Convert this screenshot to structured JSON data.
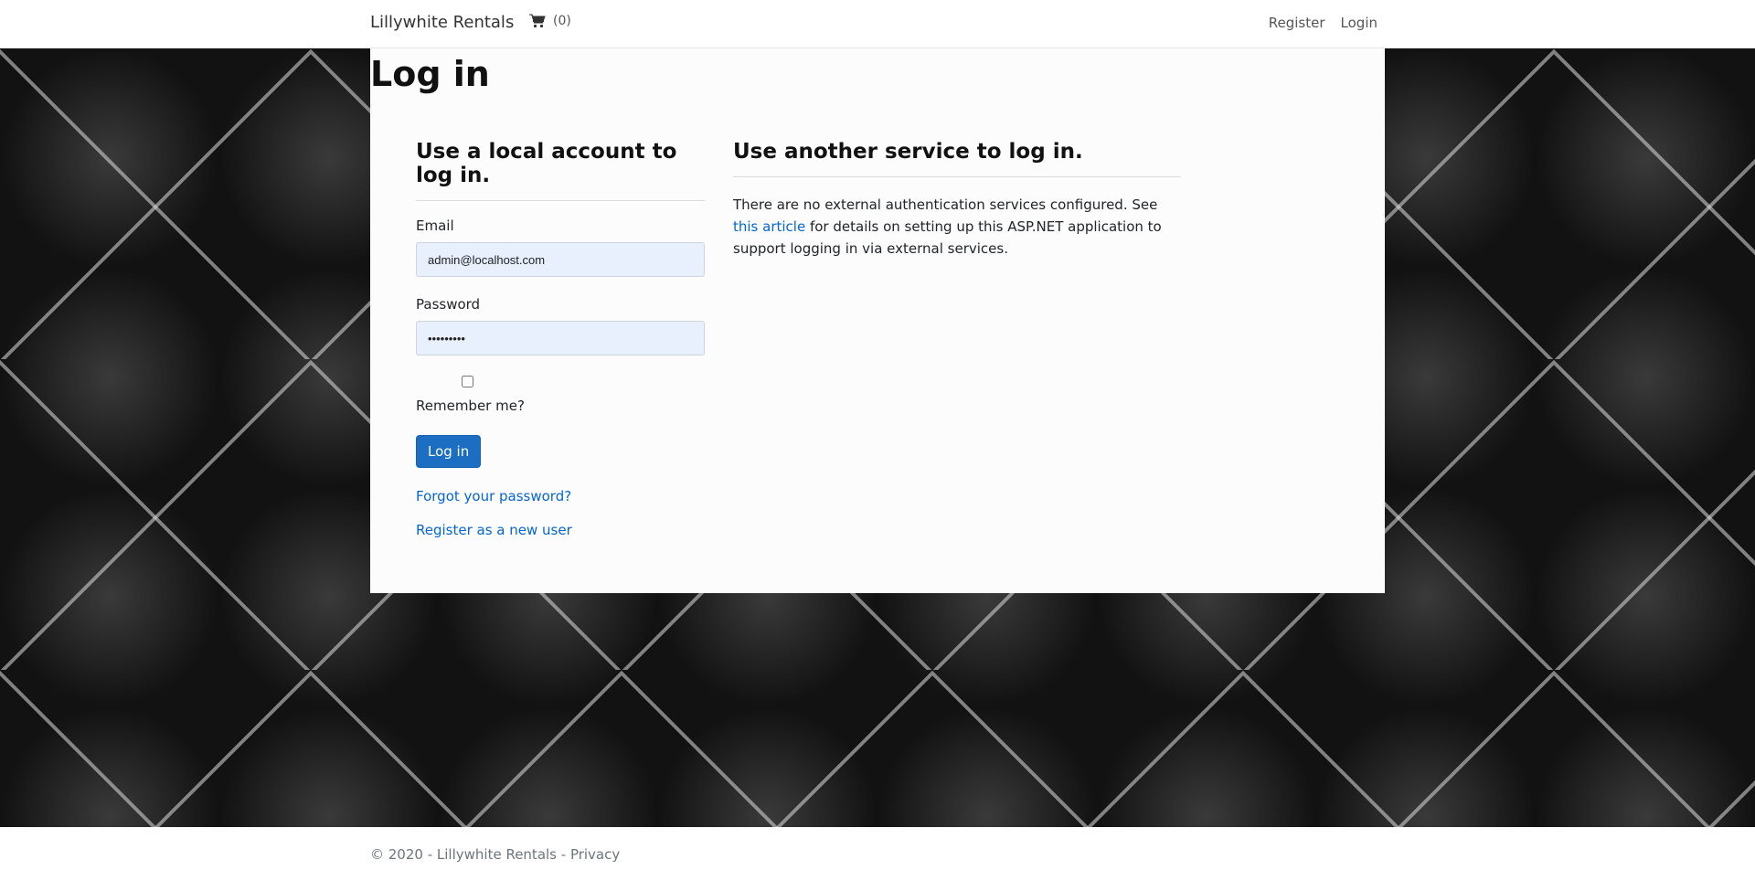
{
  "header": {
    "brand": "Lillywhite Rentals",
    "cart_icon": "shopping-cart-icon",
    "cart_count": "(0)",
    "nav": {
      "register": "Register",
      "login": "Login"
    }
  },
  "page": {
    "title": "Log in"
  },
  "local_login": {
    "heading": "Use a local account to log in.",
    "email_label": "Email",
    "email_value": "admin@localhost.com",
    "password_label": "Password",
    "password_value": "*********",
    "remember_label": "Remember me?",
    "remember_checked": false,
    "submit_label": "Log in",
    "forgot_link": "Forgot your password?",
    "register_link": "Register as a new user"
  },
  "external_login": {
    "heading": "Use another service to log in.",
    "text_before": "There are no external authentication services configured. See ",
    "link_text": "this article",
    "text_after": " for details on setting up this ASP.NET application to support logging in via external services."
  },
  "footer": {
    "text": "© 2020 - Lillywhite Rentals - ",
    "privacy_link": "Privacy"
  },
  "colors": {
    "primary_button": "#1b6ec2",
    "link": "#0366d6",
    "input_autofill_bg": "#e8f0fe"
  }
}
